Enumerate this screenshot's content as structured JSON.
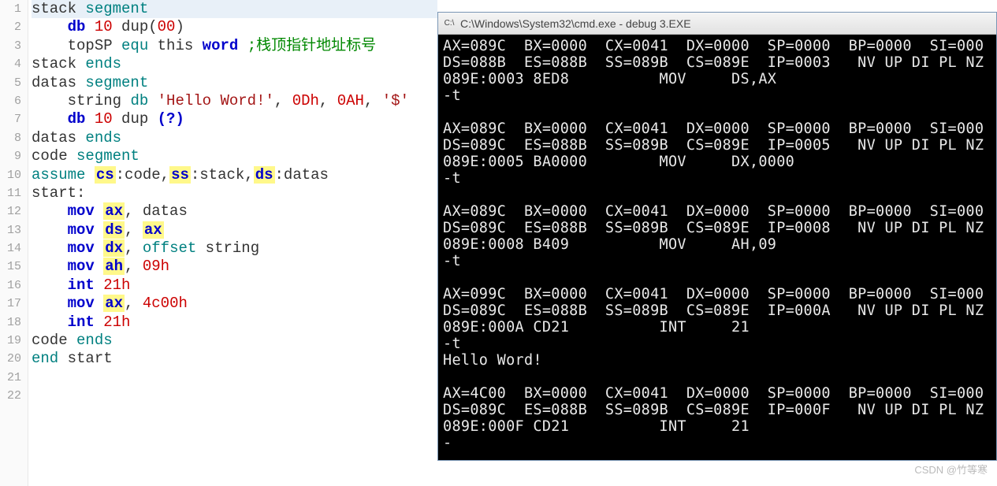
{
  "editor": {
    "lines": [
      {
        "num": "1",
        "spans": [
          {
            "cls": "plain",
            "t": "stack "
          },
          {
            "cls": "kw-teal",
            "t": "segment"
          }
        ],
        "highlight": true
      },
      {
        "num": "2",
        "indent": "    ",
        "spans": [
          {
            "cls": "kw-blue",
            "t": "db"
          },
          {
            "cls": "plain",
            "t": " "
          },
          {
            "cls": "num",
            "t": "10"
          },
          {
            "cls": "plain",
            "t": " dup("
          },
          {
            "cls": "num",
            "t": "00"
          },
          {
            "cls": "plain",
            "t": ")"
          }
        ]
      },
      {
        "num": "3",
        "indent": "    ",
        "spans": [
          {
            "cls": "plain",
            "t": "topSP "
          },
          {
            "cls": "kw-teal",
            "t": "equ"
          },
          {
            "cls": "plain",
            "t": " this "
          },
          {
            "cls": "kw-blue",
            "t": "word"
          },
          {
            "cls": "plain",
            "t": " "
          },
          {
            "cls": "cmt",
            "t": ";栈顶指针地址标号"
          }
        ]
      },
      {
        "num": "4",
        "spans": [
          {
            "cls": "plain",
            "t": "stack "
          },
          {
            "cls": "kw-teal",
            "t": "ends"
          }
        ]
      },
      {
        "num": "5",
        "spans": [
          {
            "cls": "plain",
            "t": "datas "
          },
          {
            "cls": "kw-teal",
            "t": "segment"
          }
        ]
      },
      {
        "num": "6",
        "indent": "    ",
        "spans": [
          {
            "cls": "plain",
            "t": "string "
          },
          {
            "cls": "kw-teal",
            "t": "db"
          },
          {
            "cls": "plain",
            "t": " "
          },
          {
            "cls": "str",
            "t": "'Hello Word!'"
          },
          {
            "cls": "plain",
            "t": ", "
          },
          {
            "cls": "num",
            "t": "0Dh"
          },
          {
            "cls": "plain",
            "t": ", "
          },
          {
            "cls": "num",
            "t": "0AH"
          },
          {
            "cls": "plain",
            "t": ", "
          },
          {
            "cls": "str",
            "t": "'$'"
          }
        ]
      },
      {
        "num": "7",
        "indent": "    ",
        "spans": [
          {
            "cls": "kw-blue",
            "t": "db"
          },
          {
            "cls": "plain",
            "t": " "
          },
          {
            "cls": "num",
            "t": "10"
          },
          {
            "cls": "plain",
            "t": " dup "
          },
          {
            "cls": "kw-blue",
            "t": "(?)"
          }
        ]
      },
      {
        "num": "8",
        "spans": [
          {
            "cls": "plain",
            "t": "datas "
          },
          {
            "cls": "kw-teal",
            "t": "ends"
          }
        ]
      },
      {
        "num": "9",
        "spans": [
          {
            "cls": "plain",
            "t": "code "
          },
          {
            "cls": "kw-teal",
            "t": "segment"
          }
        ]
      },
      {
        "num": "10",
        "spans": [
          {
            "cls": "kw-teal",
            "t": "assume"
          },
          {
            "cls": "plain",
            "t": " "
          },
          {
            "cls": "reg",
            "t": "cs"
          },
          {
            "cls": "plain",
            "t": ":code,"
          },
          {
            "cls": "reg",
            "t": "ss"
          },
          {
            "cls": "plain",
            "t": ":stack,"
          },
          {
            "cls": "reg",
            "t": "ds"
          },
          {
            "cls": "plain",
            "t": ":datas"
          }
        ]
      },
      {
        "num": "11",
        "spans": [
          {
            "cls": "plain",
            "t": "start:"
          }
        ]
      },
      {
        "num": "12",
        "indent": "    ",
        "spans": [
          {
            "cls": "kw-blue",
            "t": "mov"
          },
          {
            "cls": "plain",
            "t": " "
          },
          {
            "cls": "reg",
            "t": "ax"
          },
          {
            "cls": "plain",
            "t": ", datas"
          }
        ]
      },
      {
        "num": "13",
        "indent": "    ",
        "spans": [
          {
            "cls": "kw-blue",
            "t": "mov"
          },
          {
            "cls": "plain",
            "t": " "
          },
          {
            "cls": "reg",
            "t": "ds"
          },
          {
            "cls": "plain",
            "t": ", "
          },
          {
            "cls": "reg",
            "t": "ax"
          }
        ]
      },
      {
        "num": "14",
        "indent": "    ",
        "spans": [
          {
            "cls": "kw-blue",
            "t": "mov"
          },
          {
            "cls": "plain",
            "t": " "
          },
          {
            "cls": "reg",
            "t": "dx"
          },
          {
            "cls": "plain",
            "t": ", "
          },
          {
            "cls": "kw-teal",
            "t": "offset"
          },
          {
            "cls": "plain",
            "t": " string"
          }
        ]
      },
      {
        "num": "15",
        "indent": "    ",
        "spans": [
          {
            "cls": "kw-blue",
            "t": "mov"
          },
          {
            "cls": "plain",
            "t": " "
          },
          {
            "cls": "reg",
            "t": "ah"
          },
          {
            "cls": "plain",
            "t": ", "
          },
          {
            "cls": "num",
            "t": "09h"
          }
        ]
      },
      {
        "num": "16",
        "indent": "    ",
        "spans": [
          {
            "cls": "kw-blue",
            "t": "int"
          },
          {
            "cls": "plain",
            "t": " "
          },
          {
            "cls": "num",
            "t": "21h"
          }
        ]
      },
      {
        "num": "17",
        "indent": "    ",
        "spans": [
          {
            "cls": "kw-blue",
            "t": "mov"
          },
          {
            "cls": "plain",
            "t": " "
          },
          {
            "cls": "reg",
            "t": "ax"
          },
          {
            "cls": "plain",
            "t": ", "
          },
          {
            "cls": "num",
            "t": "4c00h"
          }
        ]
      },
      {
        "num": "18",
        "indent": "    ",
        "spans": [
          {
            "cls": "kw-blue",
            "t": "int"
          },
          {
            "cls": "plain",
            "t": " "
          },
          {
            "cls": "num",
            "t": "21h"
          }
        ]
      },
      {
        "num": "19",
        "spans": [
          {
            "cls": "plain",
            "t": "code "
          },
          {
            "cls": "kw-teal",
            "t": "ends"
          }
        ]
      },
      {
        "num": "20",
        "spans": [
          {
            "cls": "kw-teal",
            "t": "end"
          },
          {
            "cls": "plain",
            "t": " start"
          }
        ]
      },
      {
        "num": "21",
        "spans": []
      },
      {
        "num": "22",
        "spans": []
      }
    ]
  },
  "cmd": {
    "title": "C:\\Windows\\System32\\cmd.exe - debug  3.EXE",
    "icon": "C:\\",
    "close": "×",
    "lines": [
      "AX=089C  BX=0000  CX=0041  DX=0000  SP=0000  BP=0000  SI=000",
      "DS=088B  ES=088B  SS=089B  CS=089E  IP=0003   NV UP DI PL NZ",
      "089E:0003 8ED8          MOV     DS,AX",
      "-t",
      "",
      "AX=089C  BX=0000  CX=0041  DX=0000  SP=0000  BP=0000  SI=000",
      "DS=089C  ES=088B  SS=089B  CS=089E  IP=0005   NV UP DI PL NZ",
      "089E:0005 BA0000        MOV     DX,0000",
      "-t",
      "",
      "AX=089C  BX=0000  CX=0041  DX=0000  SP=0000  BP=0000  SI=000",
      "DS=089C  ES=088B  SS=089B  CS=089E  IP=0008   NV UP DI PL NZ",
      "089E:0008 B409          MOV     AH,09",
      "-t",
      "",
      "AX=099C  BX=0000  CX=0041  DX=0000  SP=0000  BP=0000  SI=000",
      "DS=089C  ES=088B  SS=089B  CS=089E  IP=000A   NV UP DI PL NZ",
      "089E:000A CD21          INT     21",
      "-t",
      "Hello Word!",
      "",
      "AX=4C00  BX=0000  CX=0041  DX=0000  SP=0000  BP=0000  SI=000",
      "DS=089C  ES=088B  SS=089B  CS=089E  IP=000F   NV UP DI PL NZ",
      "089E:000F CD21          INT     21",
      "-"
    ]
  },
  "watermark": "CSDN @竹等寒"
}
